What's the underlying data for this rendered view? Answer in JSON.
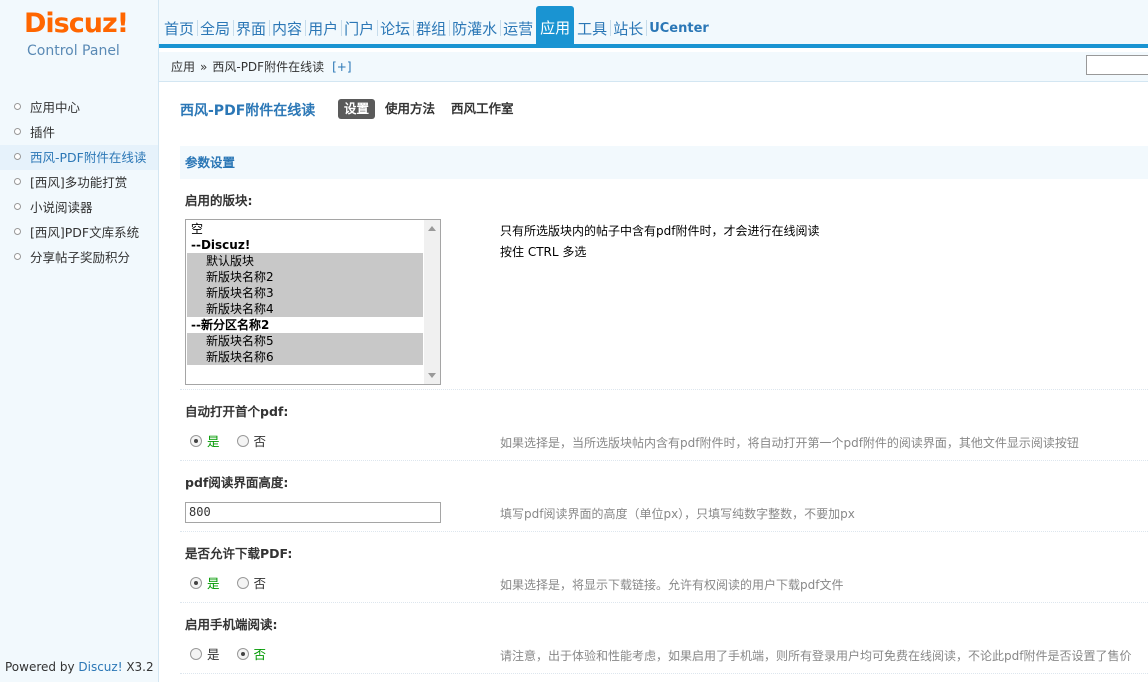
{
  "logo": {
    "brand": "Discuz",
    "bang": "!",
    "subtitle": "Control Panel"
  },
  "topnav": {
    "items": [
      "首页",
      "全局",
      "界面",
      "内容",
      "用户",
      "门户",
      "论坛",
      "群组",
      "防灌水",
      "运营",
      "应用",
      "工具",
      "站长",
      "UCenter"
    ],
    "active": "应用"
  },
  "breadcrumb": {
    "parent": "应用",
    "separator": "»",
    "current": "西风-PDF附件在线读",
    "add": "[+]"
  },
  "sidebar": {
    "items": [
      "应用中心",
      "插件",
      "西风-PDF附件在线读",
      "[西风]多功能打赏",
      "小说阅读器",
      "[西风]PDF文库系统",
      "分享帖子奖励积分"
    ],
    "active_index": 2,
    "footer_prefix": "Powered by ",
    "footer_brand": "Discuz!",
    "footer_version": " X3.2"
  },
  "main": {
    "plugin_title": "西风-PDF附件在线读",
    "tabs": [
      "设置",
      "使用方法",
      "西风工作室"
    ],
    "section_title": "参数设置",
    "fields": {
      "forums": {
        "label": "启用的版块:",
        "hint1": "只有所选版块内的帖子中含有pdf附件时，才会进行在线阅读",
        "hint2": "按住 CTRL 多选",
        "options": [
          {
            "text": "空",
            "type": "plain"
          },
          {
            "text": "--Discuz!",
            "type": "group"
          },
          {
            "text": "默认版块",
            "type": "selected"
          },
          {
            "text": "新版块名称2",
            "type": "selected"
          },
          {
            "text": "新版块名称3",
            "type": "selected"
          },
          {
            "text": "新版块名称4",
            "type": "selected"
          },
          {
            "text": "--新分区名称2",
            "type": "group"
          },
          {
            "text": "新版块名称5",
            "type": "selected"
          },
          {
            "text": "新版块名称6",
            "type": "selected"
          }
        ]
      },
      "auto_open": {
        "label": "自动打开首个pdf:",
        "yes": "是",
        "no": "否",
        "value": "yes",
        "hint": "如果选择是，当所选版块帖内含有pdf附件时，将自动打开第一个pdf附件的阅读界面，其他文件显示阅读按钮"
      },
      "height": {
        "label": "pdf阅读界面高度:",
        "value": "800",
        "hint": "填写pdf阅读界面的高度（单位px），只填写纯数字整数，不要加px"
      },
      "allow_download": {
        "label": "是否允许下载PDF:",
        "yes": "是",
        "no": "否",
        "value": "yes",
        "hint": "如果选择是，将显示下载链接。允许有权阅读的用户下载pdf文件"
      },
      "mobile": {
        "label": "启用手机端阅读:",
        "yes": "是",
        "no": "否",
        "value": "no",
        "hint": "请注意，出于体验和性能考虑，如果启用了手机端，则所有登录用户均可免费在线阅读，不论此pdf附件是否设置了售价"
      }
    }
  }
}
